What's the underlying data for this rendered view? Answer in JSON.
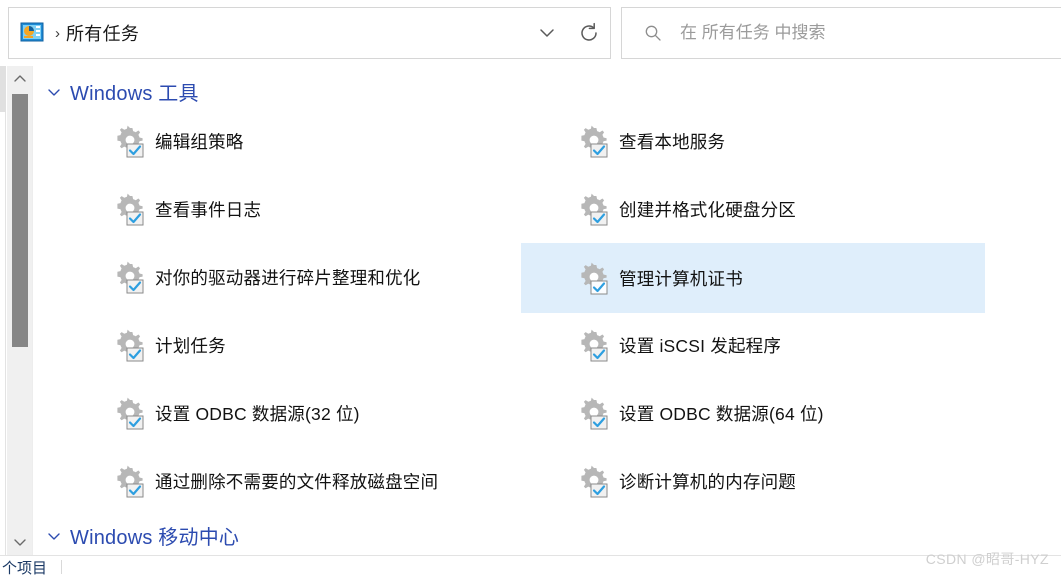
{
  "window": {
    "address": {
      "icon": "control-panel-icon",
      "separator": "›",
      "path_label": "所有任务",
      "dropdown_icon": "chevron-down-icon",
      "refresh_icon": "refresh-icon"
    },
    "search": {
      "icon": "search-icon",
      "placeholder": "在 所有任务 中搜索",
      "value": ""
    }
  },
  "scrollbar": {
    "name": "vertical-scrollbar",
    "up_icon": "chevron-up-icon",
    "down_icon": "chevron-down-icon",
    "thumb_top_pct": 6,
    "thumb_height_pct": 52
  },
  "groups": [
    {
      "id": "windows-tools",
      "title": "Windows 工具",
      "expanded": true,
      "chevron_icon": "chevron-down-icon",
      "title_color": "#2c4bb0",
      "items": [
        {
          "label": "编辑组策略",
          "icon": "gear-check-icon",
          "selected": false,
          "col": 0,
          "row": 0
        },
        {
          "label": "查看本地服务",
          "icon": "gear-check-icon",
          "selected": false,
          "col": 1,
          "row": 0
        },
        {
          "label": "查看事件日志",
          "icon": "gear-check-icon",
          "selected": false,
          "col": 0,
          "row": 1
        },
        {
          "label": "创建并格式化硬盘分区",
          "icon": "gear-check-icon",
          "selected": false,
          "col": 1,
          "row": 1
        },
        {
          "label": "对你的驱动器进行碎片整理和优化",
          "icon": "gear-check-icon",
          "selected": false,
          "col": 0,
          "row": 2
        },
        {
          "label": "管理计算机证书",
          "icon": "gear-check-icon",
          "selected": true,
          "col": 1,
          "row": 2
        },
        {
          "label": "计划任务",
          "icon": "gear-check-icon",
          "selected": false,
          "col": 0,
          "row": 3
        },
        {
          "label": "设置 iSCSI 发起程序",
          "icon": "gear-check-icon",
          "selected": false,
          "col": 1,
          "row": 3
        },
        {
          "label": "设置 ODBC 数据源(32 位)",
          "icon": "gear-check-icon",
          "selected": false,
          "col": 0,
          "row": 4
        },
        {
          "label": "设置 ODBC 数据源(64 位)",
          "icon": "gear-check-icon",
          "selected": false,
          "col": 1,
          "row": 4
        },
        {
          "label": "通过删除不需要的文件释放磁盘空间",
          "icon": "gear-check-icon",
          "selected": false,
          "col": 0,
          "row": 5
        },
        {
          "label": "诊断计算机的内存问题",
          "icon": "gear-check-icon",
          "selected": false,
          "col": 1,
          "row": 5
        }
      ]
    },
    {
      "id": "windows-mobility-center",
      "title": "Windows 移动中心",
      "expanded": true,
      "chevron_icon": "chevron-down-icon",
      "title_color": "#2c4bb0",
      "items": []
    }
  ],
  "status": {
    "text": "个项目"
  },
  "watermark": {
    "text": "CSDN @昭哥-HYZ"
  },
  "colors": {
    "selection": "#dfeefb",
    "group_title": "#2c4bb0",
    "item_text": "#121212",
    "placeholder": "#9b9b9b",
    "scrollbar_thumb": "#868686",
    "scrollbar_track": "#f0f0f0"
  }
}
